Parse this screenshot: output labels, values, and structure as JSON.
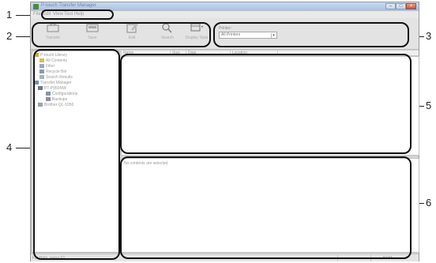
{
  "callouts": [
    "1",
    "2",
    "3",
    "4",
    "5",
    "6"
  ],
  "window": {
    "title": "P-touch Transfer Manager",
    "buttons": [
      "–",
      "□",
      "×"
    ]
  },
  "menu": [
    "File",
    "Edit",
    "View",
    "Tool",
    "Help"
  ],
  "toolbar": {
    "tools": [
      {
        "label": "Transfer",
        "icon": "transfer-icon"
      },
      {
        "label": "Save",
        "icon": "save-icon"
      },
      {
        "label": "Edit",
        "icon": "edit-icon"
      },
      {
        "label": "Search",
        "icon": "search-icon"
      },
      {
        "label": "Display Style",
        "icon": "display-style-icon"
      }
    ],
    "printer_label": "Printer:",
    "printer_value": "All Printers"
  },
  "tree": [
    "P-touch Library",
    "All Contents",
    "Filter",
    "Recycle Bin",
    "Search Results",
    "Transfer Manager",
    "PT-P950NW",
    "Configurations",
    "Backups",
    "Brother QL-1050"
  ],
  "columns": [
    "Name",
    "Size",
    "Date",
    "Location"
  ],
  "detail": {
    "message": "No contents are selected."
  },
  "status": {
    "text": "For Help, press F1",
    "num": "NUM"
  },
  "colors": {
    "callout_box": "#111111",
    "title_gradient": "#a9c0de"
  }
}
